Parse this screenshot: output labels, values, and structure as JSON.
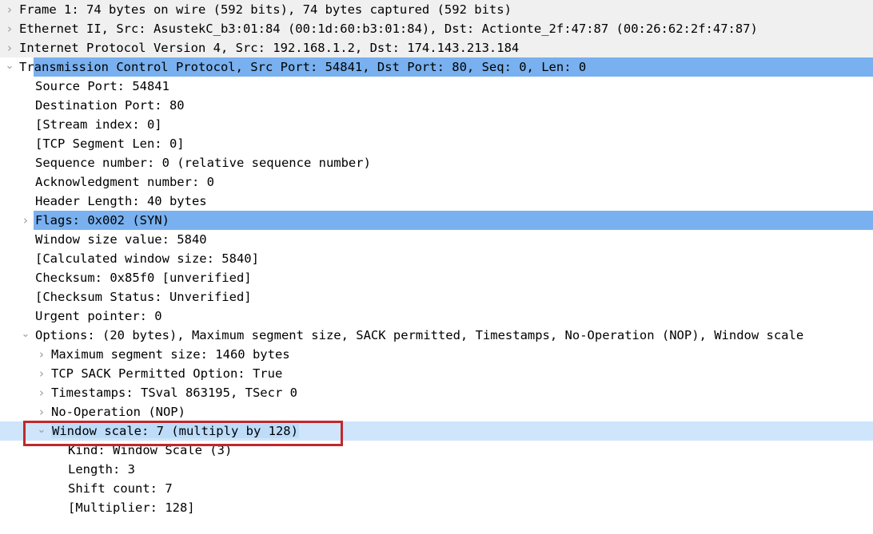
{
  "pane": {
    "name": "Wireshark packet details tree",
    "colors": {
      "selection_blue": "#79b0ef",
      "related_light_blue": "#cfe5fb",
      "header_gray": "#f0f0f0",
      "annotation_red": "#c0282c"
    }
  },
  "tree": {
    "rows": [
      {
        "label": "Frame 1: 74 bytes on wire (592 bits), 74 bytes captured (592 bits)",
        "level": 0,
        "expander": "collapsed",
        "background": "gray",
        "name": "tree-row-frame"
      },
      {
        "label": "Ethernet II, Src: AsustekC_b3:01:84 (00:1d:60:b3:01:84), Dst: Actionte_2f:47:87 (00:26:62:2f:47:87)",
        "level": 0,
        "expander": "collapsed",
        "background": "gray",
        "name": "tree-row-ethernet"
      },
      {
        "label": "Internet Protocol Version 4, Src: 192.168.1.2, Dst: 174.143.213.184",
        "level": 0,
        "expander": "collapsed",
        "background": "gray",
        "name": "tree-row-ipv4"
      },
      {
        "label": "Transmission Control Protocol, Src Port: 54841, Dst Port: 80, Seq: 0, Len: 0",
        "level": 0,
        "expander": "expanded",
        "background": "selected",
        "name": "tree-row-tcp"
      },
      {
        "label": "Source Port: 54841",
        "level": 1,
        "expander": "none",
        "background": "white",
        "name": "tree-row-source-port"
      },
      {
        "label": "Destination Port: 80",
        "level": 1,
        "expander": "none",
        "background": "white",
        "name": "tree-row-destination-port"
      },
      {
        "label": "[Stream index: 0]",
        "level": 1,
        "expander": "none",
        "background": "white",
        "name": "tree-row-stream-index"
      },
      {
        "label": "[TCP Segment Len: 0]",
        "level": 1,
        "expander": "none",
        "background": "white",
        "name": "tree-row-tcp-segment-len"
      },
      {
        "label": "Sequence number: 0    (relative sequence number)",
        "level": 1,
        "expander": "none",
        "background": "white",
        "name": "tree-row-sequence-number"
      },
      {
        "label": "Acknowledgment number: 0",
        "level": 1,
        "expander": "none",
        "background": "white",
        "name": "tree-row-acknowledgment-number"
      },
      {
        "label": "Header Length: 40 bytes",
        "level": 1,
        "expander": "none",
        "background": "white",
        "name": "tree-row-header-length"
      },
      {
        "label": "Flags: 0x002 (SYN)",
        "level": 1,
        "expander": "collapsed",
        "background": "selected",
        "name": "tree-row-flags"
      },
      {
        "label": "Window size value: 5840",
        "level": 1,
        "expander": "none",
        "background": "white",
        "name": "tree-row-window-size-value"
      },
      {
        "label": "[Calculated window size: 5840]",
        "level": 1,
        "expander": "none",
        "background": "white",
        "name": "tree-row-calculated-window-size"
      },
      {
        "label": "Checksum: 0x85f0 [unverified]",
        "level": 1,
        "expander": "none",
        "background": "white",
        "name": "tree-row-checksum"
      },
      {
        "label": "[Checksum Status: Unverified]",
        "level": 1,
        "expander": "none",
        "background": "white",
        "name": "tree-row-checksum-status"
      },
      {
        "label": "Urgent pointer: 0",
        "level": 1,
        "expander": "none",
        "background": "white",
        "name": "tree-row-urgent-pointer"
      },
      {
        "label": "Options: (20 bytes), Maximum segment size, SACK permitted, Timestamps, No-Operation (NOP), Window scale",
        "level": 1,
        "expander": "expanded",
        "background": "white",
        "name": "tree-row-options"
      },
      {
        "label": "Maximum segment size: 1460 bytes",
        "level": 2,
        "expander": "collapsed",
        "background": "white",
        "name": "tree-row-maximum-segment-size"
      },
      {
        "label": "TCP SACK Permitted Option: True",
        "level": 2,
        "expander": "collapsed",
        "background": "white",
        "name": "tree-row-sack-permitted"
      },
      {
        "label": "Timestamps: TSval 863195, TSecr 0",
        "level": 2,
        "expander": "collapsed",
        "background": "white",
        "name": "tree-row-timestamps"
      },
      {
        "label": "No-Operation (NOP)",
        "level": 2,
        "expander": "collapsed",
        "background": "white",
        "name": "tree-row-no-operation"
      },
      {
        "label": "Window scale: 7 (multiply by 128)",
        "level": 2,
        "expander": "expanded",
        "background": "light",
        "label_highlight": true,
        "name": "tree-row-window-scale"
      },
      {
        "label": "Kind: Window Scale (3)",
        "level": 3,
        "expander": "none",
        "background": "white",
        "name": "tree-row-kind"
      },
      {
        "label": "Length: 3",
        "level": 3,
        "expander": "none",
        "background": "white",
        "name": "tree-row-length"
      },
      {
        "label": "Shift count: 7",
        "level": 3,
        "expander": "none",
        "background": "white",
        "name": "tree-row-shift-count"
      },
      {
        "label": "[Multiplier: 128]",
        "level": 3,
        "expander": "none",
        "background": "white",
        "name": "tree-row-multiplier"
      }
    ]
  },
  "annotation": {
    "type": "rectangle-highlight",
    "target_row_label": "Window scale: 7 (multiply by 128)",
    "color": "#c0282c"
  }
}
